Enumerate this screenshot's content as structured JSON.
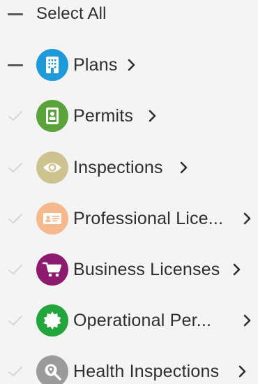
{
  "select_all": {
    "label": "Select All",
    "state": "indeterminate",
    "icon": "minus-icon"
  },
  "items": [
    {
      "label": "Plans",
      "check_state": "indeterminate",
      "icon": "building-icon",
      "icon_color": "#1f9ad9"
    },
    {
      "label": "Permits",
      "check_state": "unchecked",
      "icon": "id-card-vertical-icon",
      "icon_color": "#5aa33a"
    },
    {
      "label": "Inspections",
      "check_state": "unchecked",
      "icon": "eye-icon",
      "icon_color": "#cdc390"
    },
    {
      "label": "Professional Lice...",
      "check_state": "unchecked",
      "icon": "license-card-icon",
      "icon_color": "#f5b98d"
    },
    {
      "label": "Business Licenses",
      "check_state": "unchecked",
      "icon": "shopping-cart-icon",
      "icon_color": "#8c1a6e"
    },
    {
      "label": "Operational Per...",
      "check_state": "unchecked",
      "icon": "seal-badge-icon",
      "icon_color": "#22a53b"
    },
    {
      "label": "Health Inspections",
      "check_state": "unchecked",
      "icon": "search-location-icon",
      "icon_color": "#9b9b9b"
    }
  ],
  "colors": {
    "background": "#f4f4f4",
    "text": "#2e2e2e",
    "dash": "#595959",
    "check_faded": "#d6d6d6"
  }
}
